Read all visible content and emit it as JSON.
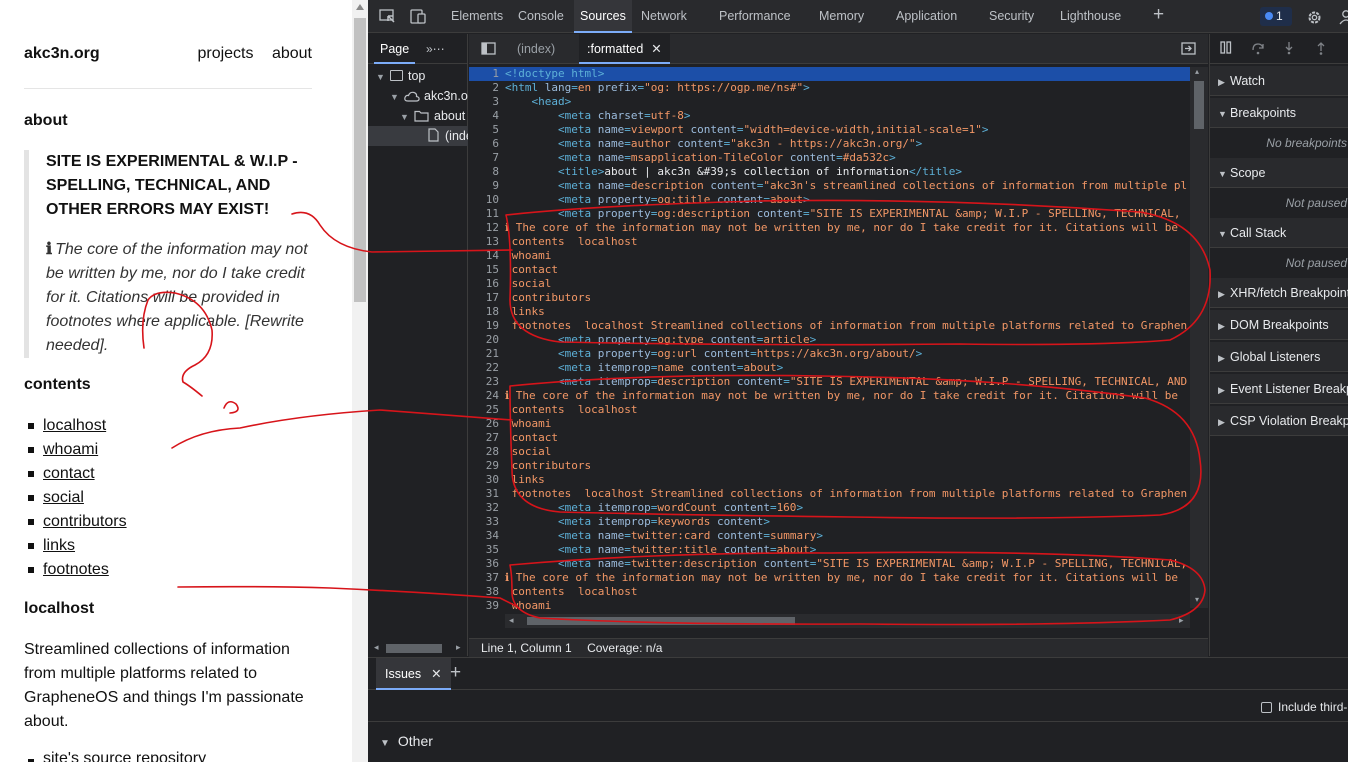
{
  "site": {
    "brand": "akc3n.org",
    "nav": [
      "projects",
      "about"
    ],
    "about_heading": "about",
    "notice_title": "SITE IS EXPERIMENTAL & W.I.P - SPELLING, TECHNICAL, AND OTHER ERRORS MAY EXIST!",
    "notice_icon": "ℹ",
    "notice_body": "The core of the information may not be written by me, nor do I take credit for it. Citations will be provided in footnotes where applicable. [Rewrite needed].",
    "contents_heading": "contents",
    "toc": [
      "localhost",
      "whoami",
      "contact",
      "social",
      "contributors",
      "links",
      "footnotes"
    ],
    "localhost_heading": "localhost",
    "localhost_text": "Streamlined collections of information from multiple platforms related to GrapheneOS and things I'm passionate about.",
    "cut_item": "site's source repository"
  },
  "devtools": {
    "tabs": [
      "Elements",
      "Console",
      "Sources",
      "Network",
      "Performance",
      "Memory",
      "Application",
      "Security",
      "Lighthouse"
    ],
    "active_tab": "Sources",
    "issues_count": "1",
    "navigator": {
      "tab": "Page",
      "tree": [
        "top",
        "akc3n.org",
        "about",
        "(index)"
      ]
    },
    "editor": {
      "tabs": [
        "(index)",
        ":formatted"
      ],
      "active_tab": ":formatted",
      "lines": [
        [
          [
            "c-tag",
            "<!doctype html>"
          ]
        ],
        [
          [
            "c-tag",
            "<html "
          ],
          [
            "c-attr",
            "lang"
          ],
          [
            "c-tag",
            "="
          ],
          [
            "c-val",
            "en"
          ],
          [
            "c-tag",
            " "
          ],
          [
            "c-attr",
            "prefix"
          ],
          [
            "c-tag",
            "="
          ],
          [
            "c-val",
            "\"og: https://ogp.me/ns#\""
          ],
          [
            "c-tag",
            ">"
          ]
        ],
        [
          [
            "c-txt",
            "    "
          ],
          [
            "c-tag",
            "<head>"
          ]
        ],
        [
          [
            "c-txt",
            "        "
          ],
          [
            "c-tag",
            "<meta "
          ],
          [
            "c-attr",
            "charset"
          ],
          [
            "c-tag",
            "="
          ],
          [
            "c-val",
            "utf-8"
          ],
          [
            "c-tag",
            ">"
          ]
        ],
        [
          [
            "c-txt",
            "        "
          ],
          [
            "c-tag",
            "<meta "
          ],
          [
            "c-attr",
            "name"
          ],
          [
            "c-tag",
            "="
          ],
          [
            "c-val",
            "viewport"
          ],
          [
            "c-tag",
            " "
          ],
          [
            "c-attr",
            "content"
          ],
          [
            "c-tag",
            "="
          ],
          [
            "c-val",
            "\"width=device-width,initial-scale=1\""
          ],
          [
            "c-tag",
            ">"
          ]
        ],
        [
          [
            "c-txt",
            "        "
          ],
          [
            "c-tag",
            "<meta "
          ],
          [
            "c-attr",
            "name"
          ],
          [
            "c-tag",
            "="
          ],
          [
            "c-val",
            "author"
          ],
          [
            "c-tag",
            " "
          ],
          [
            "c-attr",
            "content"
          ],
          [
            "c-tag",
            "="
          ],
          [
            "c-val",
            "\"akc3n - https://akc3n.org/\""
          ],
          [
            "c-tag",
            ">"
          ]
        ],
        [
          [
            "c-txt",
            "        "
          ],
          [
            "c-tag",
            "<meta "
          ],
          [
            "c-attr",
            "name"
          ],
          [
            "c-tag",
            "="
          ],
          [
            "c-val",
            "msapplication-TileColor"
          ],
          [
            "c-tag",
            " "
          ],
          [
            "c-attr",
            "content"
          ],
          [
            "c-tag",
            "="
          ],
          [
            "c-val",
            "#da532c"
          ],
          [
            "c-tag",
            ">"
          ]
        ],
        [
          [
            "c-txt",
            "        "
          ],
          [
            "c-tag",
            "<title>"
          ],
          [
            "c-txt",
            "about | akc3n &#39;s collection of information"
          ],
          [
            "c-tag",
            "</title>"
          ]
        ],
        [
          [
            "c-txt",
            "        "
          ],
          [
            "c-tag",
            "<meta "
          ],
          [
            "c-attr",
            "name"
          ],
          [
            "c-tag",
            "="
          ],
          [
            "c-val",
            "description"
          ],
          [
            "c-tag",
            " "
          ],
          [
            "c-attr",
            "content"
          ],
          [
            "c-tag",
            "="
          ],
          [
            "c-val",
            "\"akc3n's streamlined collections of information from multiple pl"
          ]
        ],
        [
          [
            "c-txt",
            "        "
          ],
          [
            "c-tag",
            "<meta "
          ],
          [
            "c-attr",
            "property"
          ],
          [
            "c-tag",
            "="
          ],
          [
            "c-val",
            "og:title"
          ],
          [
            "c-tag",
            " "
          ],
          [
            "c-attr",
            "content"
          ],
          [
            "c-tag",
            "="
          ],
          [
            "c-val",
            "about"
          ],
          [
            "c-tag",
            ">"
          ]
        ],
        [
          [
            "c-txt",
            "        "
          ],
          [
            "c-tag",
            "<meta "
          ],
          [
            "c-attr",
            "property"
          ],
          [
            "c-tag",
            "="
          ],
          [
            "c-val",
            "og:description"
          ],
          [
            "c-tag",
            " "
          ],
          [
            "c-attr",
            "content"
          ],
          [
            "c-tag",
            "="
          ],
          [
            "c-val",
            "\"SITE IS EXPERIMENTAL &amp; W.I.P - SPELLING, TECHNICAL,"
          ]
        ],
        [
          [
            "c-plain",
            "ℹ The core of the information may not be written by me, nor do I take credit for it. Citations will be"
          ]
        ],
        [
          [
            "c-plain",
            " contents  localhost"
          ]
        ],
        [
          [
            "c-plain",
            " whoami"
          ]
        ],
        [
          [
            "c-plain",
            " contact"
          ]
        ],
        [
          [
            "c-plain",
            " social"
          ]
        ],
        [
          [
            "c-plain",
            " contributors"
          ]
        ],
        [
          [
            "c-plain",
            " links"
          ]
        ],
        [
          [
            "c-plain",
            " footnotes  localhost Streamlined collections of information from multiple platforms related to Graphen"
          ]
        ],
        [
          [
            "c-txt",
            "        "
          ],
          [
            "c-tag",
            "<meta "
          ],
          [
            "c-attr",
            "property"
          ],
          [
            "c-tag",
            "="
          ],
          [
            "c-val",
            "og:type"
          ],
          [
            "c-tag",
            " "
          ],
          [
            "c-attr",
            "content"
          ],
          [
            "c-tag",
            "="
          ],
          [
            "c-val",
            "article"
          ],
          [
            "c-tag",
            ">"
          ]
        ],
        [
          [
            "c-txt",
            "        "
          ],
          [
            "c-tag",
            "<meta "
          ],
          [
            "c-attr",
            "property"
          ],
          [
            "c-tag",
            "="
          ],
          [
            "c-val",
            "og:url"
          ],
          [
            "c-tag",
            " "
          ],
          [
            "c-attr",
            "content"
          ],
          [
            "c-tag",
            "="
          ],
          [
            "c-val",
            "https://akc3n.org/about/"
          ],
          [
            "c-tag",
            ">"
          ]
        ],
        [
          [
            "c-txt",
            "        "
          ],
          [
            "c-tag",
            "<meta "
          ],
          [
            "c-attr",
            "itemprop"
          ],
          [
            "c-tag",
            "="
          ],
          [
            "c-val",
            "name"
          ],
          [
            "c-tag",
            " "
          ],
          [
            "c-attr",
            "content"
          ],
          [
            "c-tag",
            "="
          ],
          [
            "c-val",
            "about"
          ],
          [
            "c-tag",
            ">"
          ]
        ],
        [
          [
            "c-txt",
            "        "
          ],
          [
            "c-tag",
            "<meta "
          ],
          [
            "c-attr",
            "itemprop"
          ],
          [
            "c-tag",
            "="
          ],
          [
            "c-val",
            "description"
          ],
          [
            "c-tag",
            " "
          ],
          [
            "c-attr",
            "content"
          ],
          [
            "c-tag",
            "="
          ],
          [
            "c-val",
            "\"SITE IS EXPERIMENTAL &amp; W.I.P - SPELLING, TECHNICAL, AND"
          ]
        ],
        [
          [
            "c-plain",
            "ℹ The core of the information may not be written by me, nor do I take credit for it. Citations will be"
          ]
        ],
        [
          [
            "c-plain",
            " contents  localhost"
          ]
        ],
        [
          [
            "c-plain",
            " whoami"
          ]
        ],
        [
          [
            "c-plain",
            " contact"
          ]
        ],
        [
          [
            "c-plain",
            " social"
          ]
        ],
        [
          [
            "c-plain",
            " contributors"
          ]
        ],
        [
          [
            "c-plain",
            " links"
          ]
        ],
        [
          [
            "c-plain",
            " footnotes  localhost Streamlined collections of information from multiple platforms related to Graphen"
          ]
        ],
        [
          [
            "c-txt",
            "        "
          ],
          [
            "c-tag",
            "<meta "
          ],
          [
            "c-attr",
            "itemprop"
          ],
          [
            "c-tag",
            "="
          ],
          [
            "c-val",
            "wordCount"
          ],
          [
            "c-tag",
            " "
          ],
          [
            "c-attr",
            "content"
          ],
          [
            "c-tag",
            "="
          ],
          [
            "c-val",
            "160"
          ],
          [
            "c-tag",
            ">"
          ]
        ],
        [
          [
            "c-txt",
            "        "
          ],
          [
            "c-tag",
            "<meta "
          ],
          [
            "c-attr",
            "itemprop"
          ],
          [
            "c-tag",
            "="
          ],
          [
            "c-val",
            "keywords"
          ],
          [
            "c-tag",
            " "
          ],
          [
            "c-attr",
            "content"
          ],
          [
            "c-tag",
            ">"
          ]
        ],
        [
          [
            "c-txt",
            "        "
          ],
          [
            "c-tag",
            "<meta "
          ],
          [
            "c-attr",
            "name"
          ],
          [
            "c-tag",
            "="
          ],
          [
            "c-val",
            "twitter:card"
          ],
          [
            "c-tag",
            " "
          ],
          [
            "c-attr",
            "content"
          ],
          [
            "c-tag",
            "="
          ],
          [
            "c-val",
            "summary"
          ],
          [
            "c-tag",
            ">"
          ]
        ],
        [
          [
            "c-txt",
            "        "
          ],
          [
            "c-tag",
            "<meta "
          ],
          [
            "c-attr",
            "name"
          ],
          [
            "c-tag",
            "="
          ],
          [
            "c-val",
            "twitter:title"
          ],
          [
            "c-tag",
            " "
          ],
          [
            "c-attr",
            "content"
          ],
          [
            "c-tag",
            "="
          ],
          [
            "c-val",
            "about"
          ],
          [
            "c-tag",
            ">"
          ]
        ],
        [
          [
            "c-txt",
            "        "
          ],
          [
            "c-tag",
            "<meta "
          ],
          [
            "c-attr",
            "name"
          ],
          [
            "c-tag",
            "="
          ],
          [
            "c-val",
            "twitter:description"
          ],
          [
            "c-tag",
            " "
          ],
          [
            "c-attr",
            "content"
          ],
          [
            "c-tag",
            "="
          ],
          [
            "c-val",
            "\"SITE IS EXPERIMENTAL &amp; W.I.P - SPELLING, TECHNICAL,"
          ]
        ],
        [
          [
            "c-plain",
            "ℹ The core of the information may not be written by me, nor do I take credit for it. Citations will be"
          ]
        ],
        [
          [
            "c-plain",
            " contents  localhost"
          ]
        ],
        [
          [
            "c-plain",
            " whoami"
          ]
        ],
        [
          [
            "c-plain",
            ""
          ]
        ]
      ],
      "status_position": "Line 1, Column 1",
      "status_coverage": "Coverage: n/a"
    },
    "debugger": {
      "sections": [
        {
          "title": "Watch",
          "empty": ""
        },
        {
          "title": "Breakpoints",
          "empty": "No breakpoints"
        },
        {
          "title": "Scope",
          "empty": "Not paused"
        },
        {
          "title": "Call Stack",
          "empty": "Not paused"
        },
        {
          "title": "XHR/fetch Breakpoints",
          "empty": ""
        },
        {
          "title": "DOM Breakpoints",
          "empty": ""
        },
        {
          "title": "Global Listeners",
          "empty": ""
        },
        {
          "title": "Event Listener Breakpoints",
          "empty": ""
        },
        {
          "title": "CSP Violation Breakpoints",
          "empty": ""
        }
      ]
    },
    "drawer": {
      "tab": "Issues",
      "include_third": "Include third-party cookie issues",
      "other": "Other"
    }
  },
  "colors": {
    "ink": "#d7141a",
    "accent": "#7cacf8"
  }
}
